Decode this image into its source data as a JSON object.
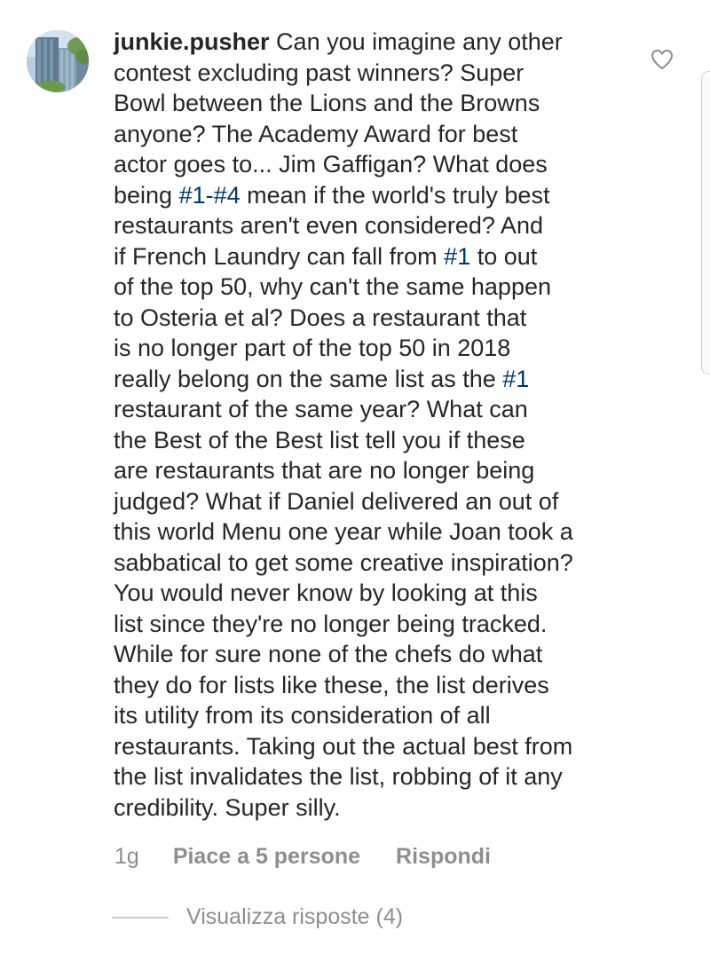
{
  "comment": {
    "username": "junkie.pusher",
    "lines": [
      [
        {
          "t": " Can you imagine any other"
        }
      ],
      [
        {
          "t": "contest excluding past winners? Super"
        }
      ],
      [
        {
          "t": "Bowl between the Lions and the Browns"
        }
      ],
      [
        {
          "t": "anyone? The Academy Award for best"
        }
      ],
      [
        {
          "t": "actor goes to... Jim Gaffigan? What does"
        }
      ],
      [
        {
          "t": "being "
        },
        {
          "t": "#1-#4",
          "h": true
        },
        {
          "t": " mean if the world's truly best"
        }
      ],
      [
        {
          "t": "restaurants aren't even considered? And"
        }
      ],
      [
        {
          "t": "if French Laundry can fall from "
        },
        {
          "t": "#1",
          "h": true
        },
        {
          "t": " to out"
        }
      ],
      [
        {
          "t": "of the top 50, why can't the same happen"
        }
      ],
      [
        {
          "t": "to Osteria et al? Does a restaurant that"
        }
      ],
      [
        {
          "t": "is no longer part of the top 50 in 2018"
        }
      ],
      [
        {
          "t": "really belong on the same list as the "
        },
        {
          "t": "#1",
          "h": true
        }
      ],
      [
        {
          "t": "restaurant of the same year? What can"
        }
      ],
      [
        {
          "t": "the Best of the Best list tell you if these"
        }
      ],
      [
        {
          "t": "are restaurants that are no longer being"
        }
      ],
      [
        {
          "t": "judged? What if Daniel delivered an out of"
        }
      ],
      [
        {
          "t": "this world Menu one year while Joan took a"
        }
      ],
      [
        {
          "t": "sabbatical to get some creative inspiration?"
        }
      ],
      [
        {
          "t": "You would never know by looking at this"
        }
      ],
      [
        {
          "t": "list since they're no longer being tracked."
        }
      ],
      [
        {
          "t": "While for sure none of the chefs do what"
        }
      ],
      [
        {
          "t": "they do for lists like these, the list derives"
        }
      ],
      [
        {
          "t": "its utility from its consideration of all"
        }
      ],
      [
        {
          "t": "restaurants. Taking out the actual best from"
        }
      ],
      [
        {
          "t": "the list invalidates the list, robbing of it any"
        }
      ],
      [
        {
          "t": "credibility. Super silly."
        }
      ]
    ],
    "time": "1g",
    "likes_label": "Piace a 5 persone",
    "reply_label": "Rispondi",
    "view_replies_label": "Visualizza risposte (4)"
  },
  "icons": {
    "avatar": "avatar-building-photo",
    "like": "heart-outline-icon"
  },
  "colors": {
    "text": "#262626",
    "hashtag": "#00376b",
    "muted": "#8e8e8e"
  }
}
